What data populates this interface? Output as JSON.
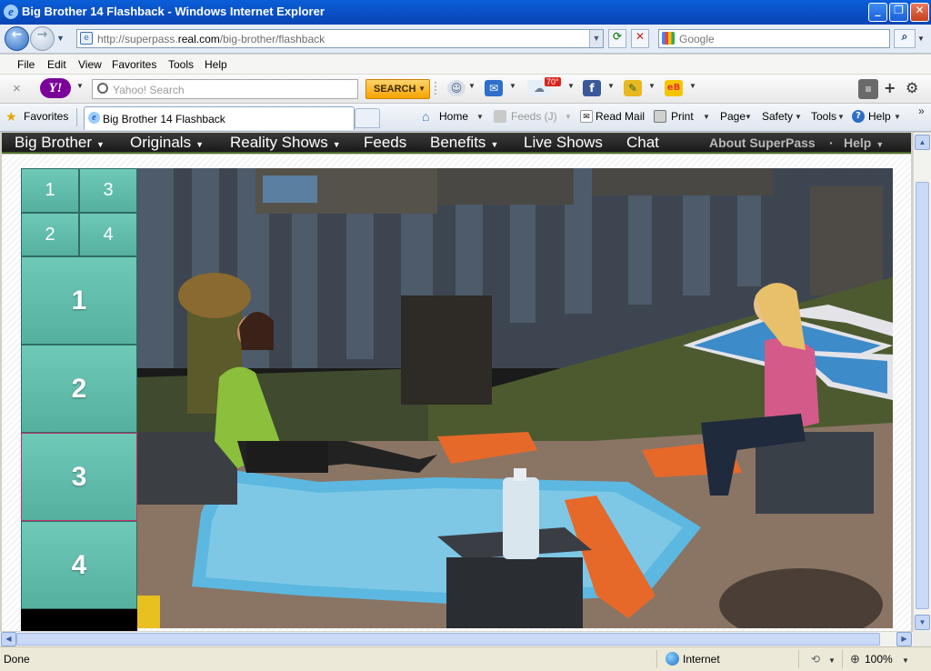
{
  "window": {
    "title": "Big Brother 14 Flashback - Windows Internet Explorer",
    "controls": [
      "_",
      "❐",
      "✕"
    ]
  },
  "address": {
    "url_prefix": "http://superpass.",
    "url_domain": "real.com",
    "url_path": "/big-brother/flashback",
    "search_placeholder": "Google"
  },
  "menubar": [
    {
      "underline": "F",
      "rest": "ile"
    },
    {
      "underline": "E",
      "rest": "dit"
    },
    {
      "underline": "V",
      "rest": "iew"
    },
    {
      "underline": "",
      "rest": "F",
      "full": "Favorites",
      "ul_index": 0
    },
    {
      "underline": "T",
      "rest": "ools"
    },
    {
      "underline": "H",
      "rest": "elp"
    }
  ],
  "menubar_labels": [
    "File",
    "Edit",
    "View",
    "Favorites",
    "Tools",
    "Help"
  ],
  "yahoo_toolbar": {
    "close": "×",
    "logo": "Y!",
    "search_placeholder": "Yahoo! Search",
    "search_button": "SEARCH",
    "weather": "70°"
  },
  "favorites_bar": {
    "favorites_label": "Favorites",
    "tab_title": "Big Brother 14 Flashback",
    "home": "Home",
    "feeds": "Feeds (J)",
    "read_mail": "Read Mail",
    "print": "Print",
    "page": "Page",
    "safety": "Safety",
    "tools": "Tools",
    "help": "Help"
  },
  "site_nav": {
    "items": [
      "Big Brother",
      "Originals",
      "Reality Shows",
      "Feeds",
      "Benefits",
      "Live Shows",
      "Chat"
    ],
    "dropdown": [
      true,
      true,
      true,
      false,
      true,
      false,
      false
    ],
    "right_items": [
      "About SuperPass",
      "Help"
    ],
    "separator": "·"
  },
  "cam_grid": {
    "small": [
      "1",
      "3",
      "2",
      "4"
    ],
    "big": [
      "1",
      "2",
      "3",
      "4"
    ],
    "active_big": "3"
  },
  "status": {
    "left": "Done",
    "zone": "Internet",
    "zoom": "100%"
  },
  "colors": {
    "cam_teal": "#62bcab",
    "active_border": "#c0306c",
    "nav_bg": "#262626"
  }
}
